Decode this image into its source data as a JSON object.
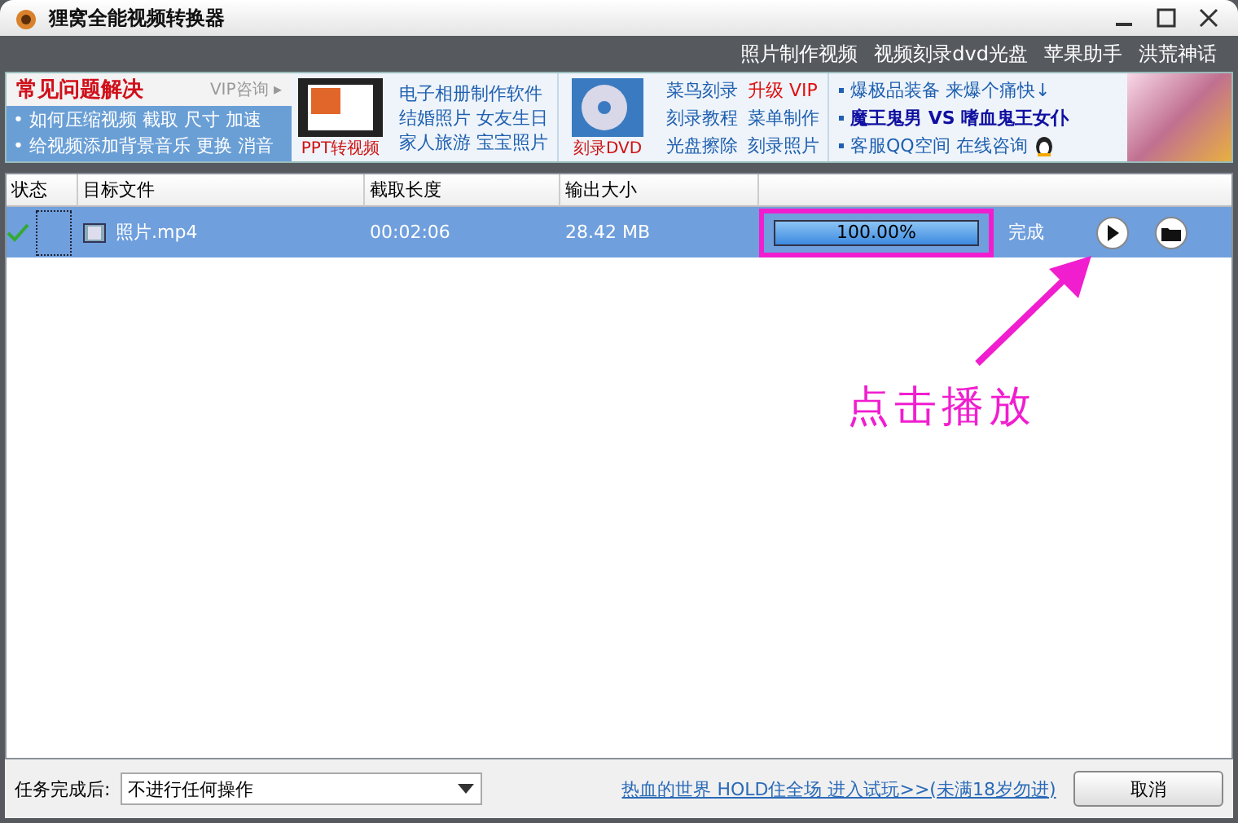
{
  "window": {
    "title": "狸窝全能视频转换器"
  },
  "top_links": [
    "照片制作视频",
    "视频刻录dvd光盘",
    "苹果助手",
    "洪荒神话"
  ],
  "promo": {
    "faq": {
      "title": "常见问题解决",
      "vip_link": "VIP咨询 ▸",
      "lines": [
        "• 如何压缩视频 截取 尺寸 加速",
        "• 给视频添加背景音乐 更换 消音"
      ]
    },
    "ppt_label": "PPT转视频",
    "album_links": [
      "电子相册制作软件",
      "结婚照片 女友生日",
      "家人旅游 宝宝照片"
    ],
    "dvd_label": "刻录DVD",
    "burn_links": [
      [
        {
          "text": "菜鸟刻录",
          "hot": false
        },
        {
          "text": "升级 VIP",
          "hot": true
        }
      ],
      [
        {
          "text": "刻录教程",
          "hot": false
        },
        {
          "text": "菜单制作",
          "hot": false
        }
      ],
      [
        {
          "text": "光盘擦除",
          "hot": false
        },
        {
          "text": "刻录照片",
          "hot": false
        }
      ]
    ],
    "game_links": [
      {
        "text": "爆极品装备 来爆个痛快↓",
        "bold": false
      },
      {
        "text": "魔王鬼男 VS 嗜血鬼王女仆",
        "bold": true
      },
      {
        "text": "客服QQ空间 在线咨询",
        "bold": false
      }
    ]
  },
  "table": {
    "columns": [
      "状态",
      "目标文件",
      "截取长度",
      "输出大小"
    ],
    "rows": [
      {
        "selected": true,
        "done": true,
        "file": "照片.mp4",
        "duration": "00:02:06",
        "size": "28.42 MB",
        "level": 1,
        "progress_text": "100.00%",
        "status_text": "完成"
      }
    ]
  },
  "annotation": {
    "text": "点击播放"
  },
  "bottom": {
    "after_label": "任务完成后:",
    "after_value": "不进行任何操作",
    "link": "热血的世界 HOLD住全场 进入试玩>>(未满18岁勿进)",
    "cancel": "取消"
  }
}
